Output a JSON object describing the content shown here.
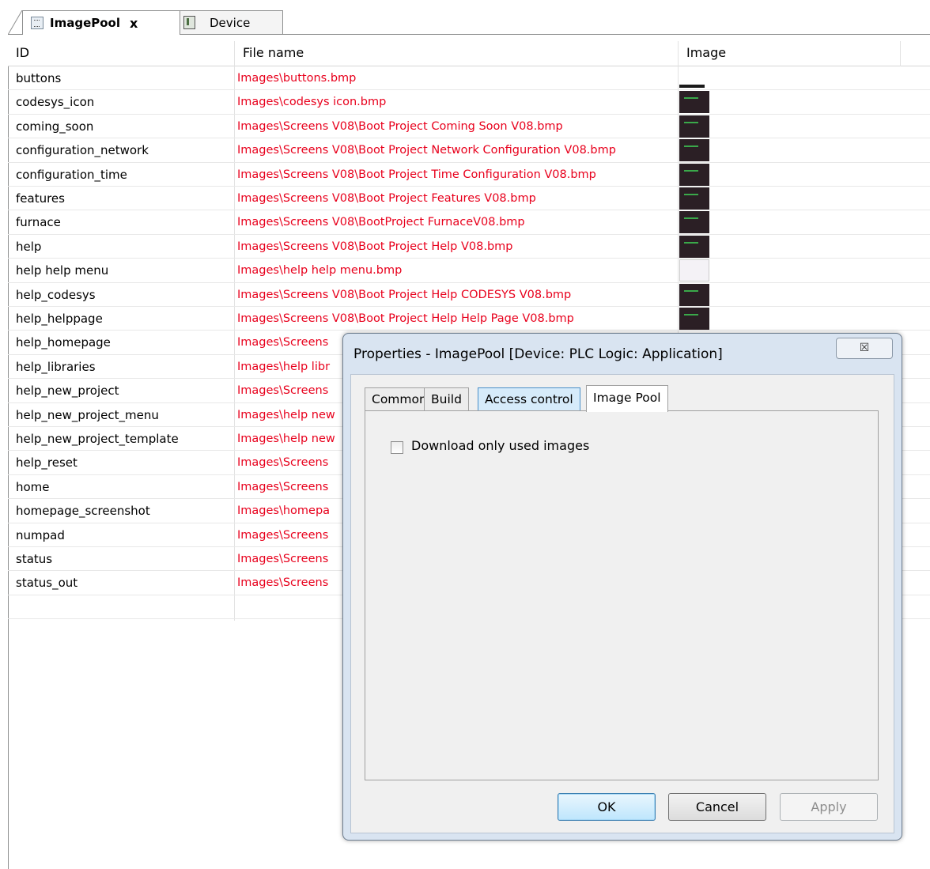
{
  "tabs": [
    {
      "label": "ImagePool",
      "close": "x",
      "active": true
    },
    {
      "label": "Device",
      "active": false
    }
  ],
  "table": {
    "columns": [
      "ID",
      "File name",
      "Image"
    ],
    "rows": [
      {
        "id": "buttons",
        "file": "Images\\buttons.bmp",
        "thumb": "btns"
      },
      {
        "id": "codesys_icon",
        "file": "Images\\codesys icon.bmp",
        "thumb": "dark"
      },
      {
        "id": "coming_soon",
        "file": "Images\\Screens V08\\Boot Project Coming Soon V08.bmp",
        "thumb": "dark"
      },
      {
        "id": "configuration_network",
        "file": "Images\\Screens V08\\Boot Project Network Configuration V08.bmp",
        "thumb": "dark"
      },
      {
        "id": "configuration_time",
        "file": "Images\\Screens V08\\Boot Project Time Configuration V08.bmp",
        "thumb": "dark"
      },
      {
        "id": "features",
        "file": "Images\\Screens V08\\Boot Project Features V08.bmp",
        "thumb": "dark"
      },
      {
        "id": "furnace",
        "file": "Images\\Screens V08\\BootProject FurnaceV08.bmp",
        "thumb": "dark"
      },
      {
        "id": "help",
        "file": "Images\\Screens V08\\Boot Project Help V08.bmp",
        "thumb": "dark"
      },
      {
        "id": "help help menu",
        "file": "Images\\help help menu.bmp",
        "thumb": "light"
      },
      {
        "id": "help_codesys",
        "file": "Images\\Screens V08\\Boot Project Help CODESYS V08.bmp",
        "thumb": "dark"
      },
      {
        "id": "help_helppage",
        "file": "Images\\Screens V08\\Boot Project Help Help Page V08.bmp",
        "thumb": "dark"
      },
      {
        "id": "help_homepage",
        "file": "Images\\Screens",
        "thumb": "none"
      },
      {
        "id": "help_libraries",
        "file": "Images\\help libr",
        "thumb": "none"
      },
      {
        "id": "help_new_project",
        "file": "Images\\Screens",
        "thumb": "none"
      },
      {
        "id": "help_new_project_menu",
        "file": "Images\\help new",
        "thumb": "none"
      },
      {
        "id": "help_new_project_template",
        "file": "Images\\help new",
        "thumb": "none"
      },
      {
        "id": "help_reset",
        "file": "Images\\Screens",
        "thumb": "none"
      },
      {
        "id": "home",
        "file": "Images\\Screens",
        "thumb": "none"
      },
      {
        "id": "homepage_screenshot",
        "file": "Images\\homepa",
        "thumb": "none"
      },
      {
        "id": "numpad",
        "file": "Images\\Screens",
        "thumb": "none"
      },
      {
        "id": "status",
        "file": "Images\\Screens",
        "thumb": "none"
      },
      {
        "id": "status_out",
        "file": "Images\\Screens",
        "thumb": "none"
      },
      {
        "id": "",
        "file": "",
        "thumb": "none"
      }
    ]
  },
  "dialog": {
    "title": "Properties - ImagePool [Device: PLC Logic: Application]",
    "close_glyph": "☒",
    "tabs": [
      "Common",
      "Build",
      "Access control",
      "Image Pool"
    ],
    "active_tab": "Image Pool",
    "checkbox_label": "Download only used images",
    "checkbox_checked": false,
    "ok_label": "OK",
    "cancel_label": "Cancel",
    "apply_label": "Apply"
  },
  "colors": {
    "file_text": "#e8001c",
    "dialog_frame": "#d9e4f1",
    "highlight_tab": "#d6ebfa"
  }
}
